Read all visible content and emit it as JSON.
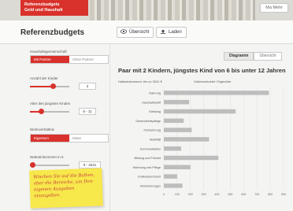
{
  "banner": {
    "brand_line1": "Referenzbudgets",
    "brand_line2": "Geld und Haushalt",
    "more_link": "Ma Mehr"
  },
  "toolbar": {
    "title": "Referenzbudgets",
    "overview_label": "Übersicht",
    "load_label": "Laden"
  },
  "form": {
    "household_label": "Haushaltsgemeinschaft",
    "household_options": [
      "Mit Partner",
      "Ohne Partner"
    ],
    "household_selected": 0,
    "children_label": "Anzahl der Kinder",
    "children_value": "2",
    "children_fraction": 0.5,
    "youngest_label": "Alter des jüngsten Kindes",
    "youngest_value": "6 - 11",
    "youngest_fraction": 0.3,
    "housing_label": "Wohnverhältnis",
    "housing_options": [
      "Eigentum",
      "Miete"
    ],
    "housing_selected": 0,
    "income_label": "Nettoeinkommen in €",
    "income_value": "0 - 3241",
    "income_fraction": 0.0
  },
  "sticky_note": {
    "text_line1": "Wischen Sie auf die Balken,",
    "text_line2": "aber die Bereiche, um Ihre",
    "text_line3": "eigenen Ausgaben einzugeben."
  },
  "tabs": {
    "diagram": "Diagramm",
    "overview": "Übersicht",
    "active": "diagram"
  },
  "chart": {
    "title": "Paar mit 2 Kindern, jüngstes Kind von 6 bis unter 12 Jahren",
    "left_subtitle": "Haltseinkommen: bis zu 3241 €",
    "right_subtitle": "Vollverschuldet / Eigentüm"
  },
  "chart_data": {
    "type": "bar",
    "orientation": "horizontal",
    "categories": [
      "Nahrung",
      "Haushaltsstoff",
      "Kleidung",
      "Gesundheitspflege",
      "Fernsehrung",
      "Mobilität",
      "Kommunikation",
      "Bildung und Freizeit",
      "Wohnung und Pflege",
      "Endkosten/Sonst",
      "Versicherungen"
    ],
    "values": [
      790,
      190,
      540,
      150,
      210,
      340,
      130,
      410,
      200,
      100,
      140
    ],
    "xlim": [
      0,
      900
    ],
    "xticks": [
      0,
      100,
      200,
      300,
      400,
      500,
      600,
      700,
      800,
      900
    ],
    "grid": true,
    "bar_color": "#bdbdbd"
  },
  "colors": {
    "accent": "#d9312b",
    "note": "#f7e84c"
  }
}
